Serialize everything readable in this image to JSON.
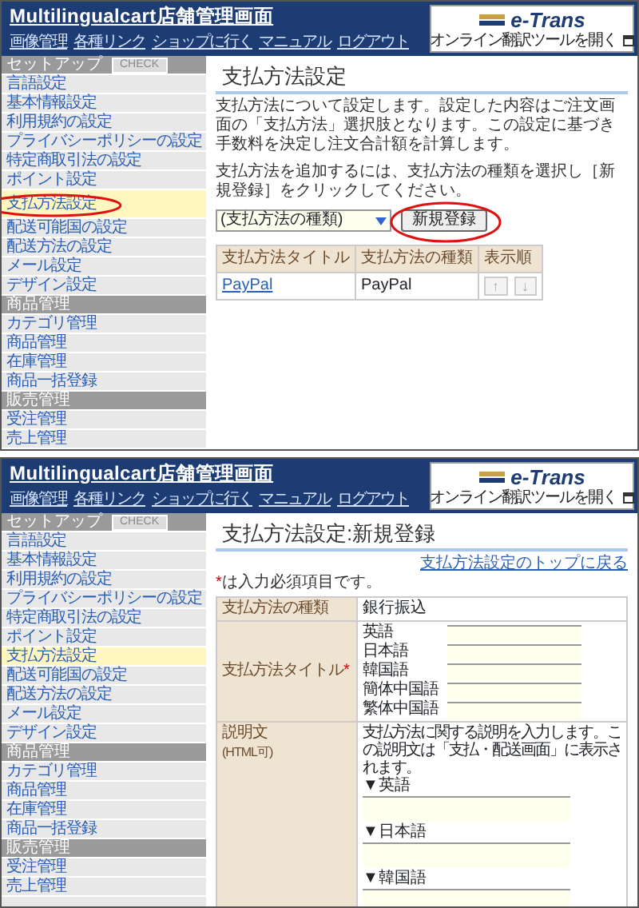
{
  "screens": [
    {
      "header": {
        "title": "Multilingualcart店舗管理画面",
        "nav": [
          "画像管理",
          "各種リンク",
          "ショップに行く",
          "マニュアル",
          "ログアウト"
        ],
        "logo": {
          "name": "e-Trans",
          "caption": "オンライン翻訳ツールを開く"
        }
      },
      "sidebar": [
        {
          "title": "セットアップ",
          "button": "CHECK",
          "items": [
            {
              "label": "言語設定",
              "selected": false,
              "circled": false
            },
            {
              "label": "基本情報設定",
              "selected": false,
              "circled": false
            },
            {
              "label": "利用規約の設定",
              "selected": false,
              "circled": false
            },
            {
              "label": "プライバシーポリシーの設定",
              "selected": false,
              "circled": false
            },
            {
              "label": "特定商取引法の設定",
              "selected": false,
              "circled": false
            },
            {
              "label": "ポイント設定",
              "selected": false,
              "circled": false
            },
            {
              "label": "支払方法設定",
              "selected": true,
              "circled": true
            },
            {
              "label": "配送可能国の設定",
              "selected": false,
              "circled": false
            },
            {
              "label": "配送方法の設定",
              "selected": false,
              "circled": false
            },
            {
              "label": "メール設定",
              "selected": false,
              "circled": false
            },
            {
              "label": "デザイン設定",
              "selected": false,
              "circled": false
            }
          ]
        },
        {
          "title": "商品管理",
          "items": [
            {
              "label": "カテゴリ管理",
              "selected": false,
              "circled": false
            },
            {
              "label": "商品管理",
              "selected": false,
              "circled": false
            },
            {
              "label": "在庫管理",
              "selected": false,
              "circled": false
            },
            {
              "label": "商品一括登録",
              "selected": false,
              "circled": false
            }
          ]
        },
        {
          "title": "販売管理",
          "items": [
            {
              "label": "受注管理",
              "selected": false,
              "circled": false
            },
            {
              "label": "売上管理",
              "selected": false,
              "circled": false
            }
          ]
        }
      ],
      "content": {
        "kind": "list",
        "title": "支払方法設定",
        "intro": "支払方法について設定します。設定した内容はご注文画面の「支払方法」選択肢となります。この設定に基づき手数料を決定し注文合計額を計算します。",
        "instruction": "支払方法を追加するには、支払方法の種類を選択し［新規登録］をクリックしてください。",
        "select": "(支払方法の種類)",
        "button": {
          "label": "新規登録",
          "circled": true
        },
        "table": {
          "columns": [
            "支払方法タイトル",
            "支払方法の種類",
            "表示順"
          ],
          "rows": [
            {
              "title": "PayPal",
              "type": "PayPal",
              "order": [
                {
                  "label": "↑",
                  "disabled": true
                },
                {
                  "label": "↓",
                  "disabled": true
                }
              ]
            }
          ]
        }
      }
    },
    {
      "header": {
        "title": "Multilingualcart店舗管理画面",
        "nav": [
          "画像管理",
          "各種リンク",
          "ショップに行く",
          "マニュアル",
          "ログアウト"
        ],
        "logo": {
          "name": "e-Trans",
          "caption": "オンライン翻訳ツールを開く"
        }
      },
      "sidebar": [
        {
          "title": "セットアップ",
          "button": "CHECK",
          "items": [
            {
              "label": "言語設定",
              "selected": false,
              "circled": false
            },
            {
              "label": "基本情報設定",
              "selected": false,
              "circled": false
            },
            {
              "label": "利用規約の設定",
              "selected": false,
              "circled": false
            },
            {
              "label": "プライバシーポリシーの設定",
              "selected": false,
              "circled": false
            },
            {
              "label": "特定商取引法の設定",
              "selected": false,
              "circled": false
            },
            {
              "label": "ポイント設定",
              "selected": false,
              "circled": false
            },
            {
              "label": "支払方法設定",
              "selected": true,
              "circled": false
            },
            {
              "label": "配送可能国の設定",
              "selected": false,
              "circled": false
            },
            {
              "label": "配送方法の設定",
              "selected": false,
              "circled": false
            },
            {
              "label": "メール設定",
              "selected": false,
              "circled": false
            },
            {
              "label": "デザイン設定",
              "selected": false,
              "circled": false
            }
          ]
        },
        {
          "title": "商品管理",
          "items": [
            {
              "label": "カテゴリ管理",
              "selected": false,
              "circled": false
            },
            {
              "label": "商品管理",
              "selected": false,
              "circled": false
            },
            {
              "label": "在庫管理",
              "selected": false,
              "circled": false
            },
            {
              "label": "商品一括登録",
              "selected": false,
              "circled": false
            }
          ]
        },
        {
          "title": "販売管理",
          "items": [
            {
              "label": "受注管理",
              "selected": false,
              "circled": false
            },
            {
              "label": "売上管理",
              "selected": false,
              "circled": false
            }
          ]
        }
      ],
      "content": {
        "kind": "form",
        "title": "支払方法設定:新規登録",
        "back_link": "支払方法設定のトップに戻る",
        "required_mark": "*",
        "required_note": "は入力必須項目です。",
        "type_row": {
          "label": "支払方法の種類",
          "value": "銀行振込"
        },
        "title_row": {
          "label": "支払方法タイトル",
          "required": true,
          "languages": [
            "英語",
            "日本語",
            "韓国語",
            "簡体中国語",
            "繁体中国語"
          ]
        },
        "description_row": {
          "label": "説明文",
          "sublabel": "(HTML可)",
          "help": "支払方法に関する説明を入力します。この説明文は「支払・配送画面」に表示されます。",
          "languages": [
            "▼英語",
            "▼日本語",
            "▼韓国語"
          ]
        }
      }
    }
  ]
}
